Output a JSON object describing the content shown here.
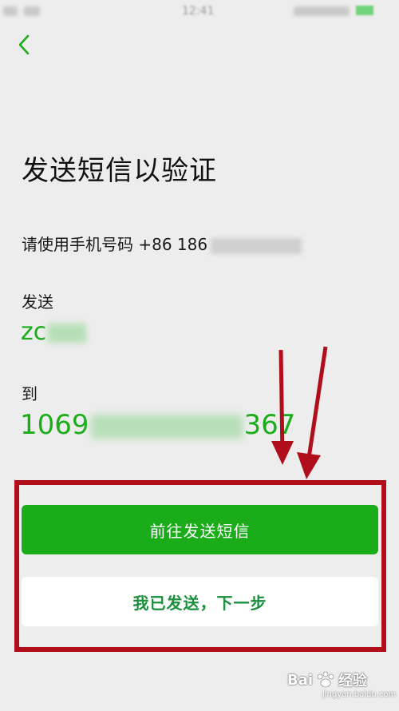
{
  "status_bar": {
    "time": "12:41"
  },
  "header": {
    "back_label": "<"
  },
  "page": {
    "title": "发送短信以验证",
    "phone_prefix": "请使用手机号码 +86 186",
    "send_label": "发送",
    "content_prefix": "zc",
    "to_label": "到",
    "number_prefix": "1069",
    "number_suffix": "367"
  },
  "buttons": {
    "primary_label": "前往发送短信",
    "secondary_label": "我已发送，下一步"
  },
  "watermark": {
    "brand": "Bai",
    "brand_suffix": "经验",
    "url": "jingyan.baidu.com"
  },
  "colors": {
    "accent": "#1aad19",
    "annotation": "#b00e1a",
    "background": "#ededed"
  }
}
